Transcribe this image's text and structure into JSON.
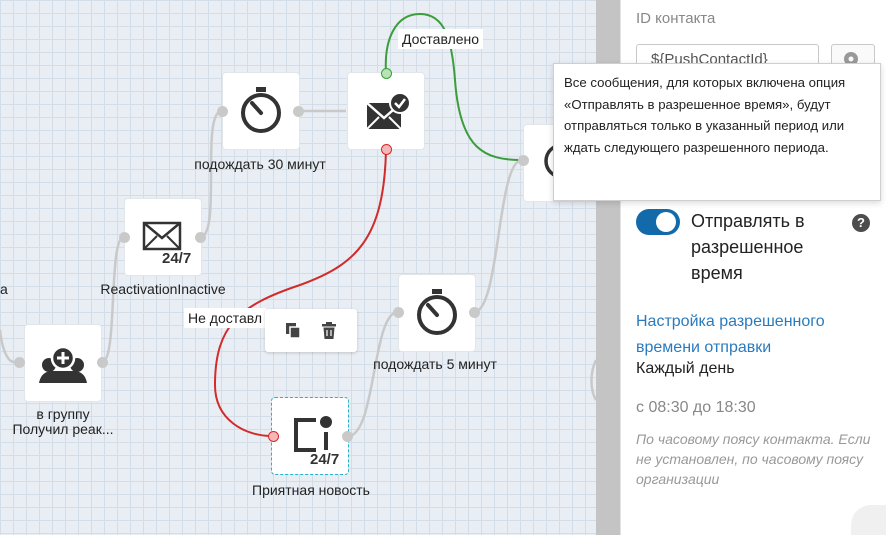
{
  "canvas": {
    "nodes": {
      "wait30": {
        "label": "подождать 30 минут"
      },
      "reactivation": {
        "label": "ReactivationInactive",
        "badge": "24/7"
      },
      "group": {
        "label_line1": "в группу",
        "label_line2": "Получил реак..."
      },
      "wait5": {
        "label": "подождать 5 минут"
      },
      "pleasant": {
        "label": "Приятная новость",
        "badge": "24/7"
      },
      "partial_left": {
        "label": "а"
      }
    },
    "edges": {
      "delivered": "Доставлено",
      "not_delivered": "Не доставл"
    },
    "toolbar": {
      "copy": "copy-icon",
      "delete": "trash-icon"
    },
    "colors": {
      "green": "#3b9d3b",
      "red": "#d12b2b",
      "grey": "#c9c9c9",
      "selection": "#26b4c9"
    }
  },
  "panel": {
    "contact_title": "ID контакта",
    "contact_value": "${PushContactId}",
    "toggle_label": "Отправлять в разрешенное время",
    "toggle_on": true,
    "help": "?",
    "time_link": "Настройка разрешенного времени отправки",
    "every_day": "Каждый день",
    "time_range": "с 08:30 до 18:30",
    "tz_note": "По часовому поясу контакта. Если не установлен, по часовому поясу организации",
    "accent_color": "#136aab",
    "link_color": "#2a7bbd"
  },
  "tooltip": {
    "text": "Все сообщения, для которых включена опция «Отправлять в разрешенное время», будут отправляться только в указанный период или ждать следующего разрешенного периода."
  }
}
